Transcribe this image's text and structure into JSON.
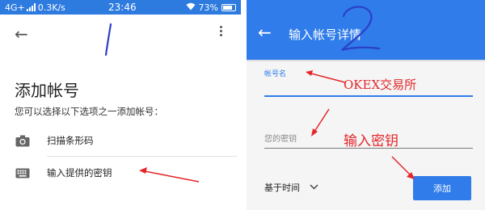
{
  "status_bar": {
    "network": "4G+",
    "speed": "0.3K/s",
    "time": "23:46",
    "battery": "73%"
  },
  "left_screen": {
    "title": "添加帐号",
    "subtitle": "您可以选择以下选项之一添加帐号：",
    "options": [
      {
        "label": "扫描条形码",
        "icon": "camera-icon"
      },
      {
        "label": "输入提供的密钥",
        "icon": "keyboard-icon"
      }
    ],
    "annotation_number": "1"
  },
  "right_screen": {
    "title": "输入帐号详情",
    "account_name_label": "帐号名",
    "key_placeholder": "您的密钥",
    "time_based_label": "基于时间",
    "add_button_label": "添加",
    "annotation_number": "2",
    "annotation_exchange": "OKEX交易所",
    "annotation_key": "输入密钥"
  },
  "colors": {
    "accent_blue": "#2f7cea",
    "annotation_red": "#e3262a",
    "annotation_ink": "#2c3fc9"
  }
}
